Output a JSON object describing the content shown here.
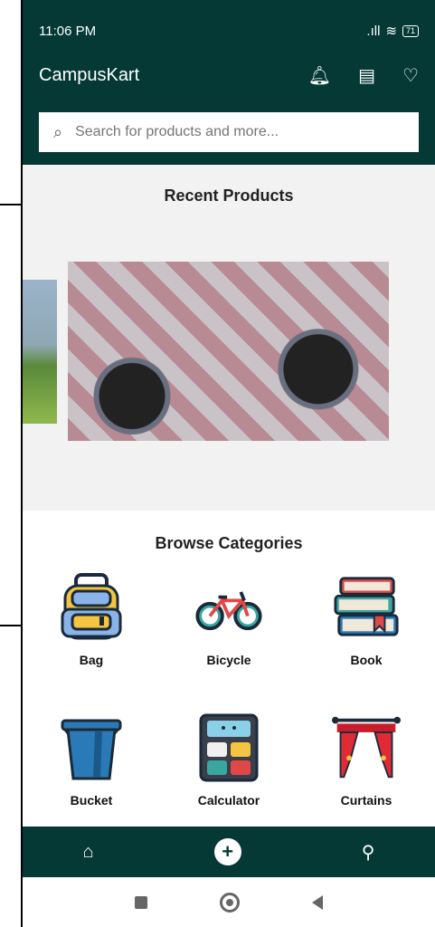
{
  "status_bar": {
    "time": "11:06 PM",
    "battery": "71"
  },
  "app": {
    "title": "CampusKart"
  },
  "search": {
    "placeholder": "Search for products and more..."
  },
  "recent": {
    "title": "Recent Products"
  },
  "browse": {
    "title": "Browse Categories",
    "categories": [
      {
        "label": "Bag"
      },
      {
        "label": "Bicycle"
      },
      {
        "label": "Book"
      },
      {
        "label": "Bucket"
      },
      {
        "label": "Calculator"
      },
      {
        "label": "Curtains"
      }
    ]
  },
  "bottom_nav": {
    "items": [
      "home-icon",
      "add-icon",
      "profile-icon"
    ]
  },
  "colors": {
    "primary": "#053936",
    "background": "#f2f2f2"
  }
}
